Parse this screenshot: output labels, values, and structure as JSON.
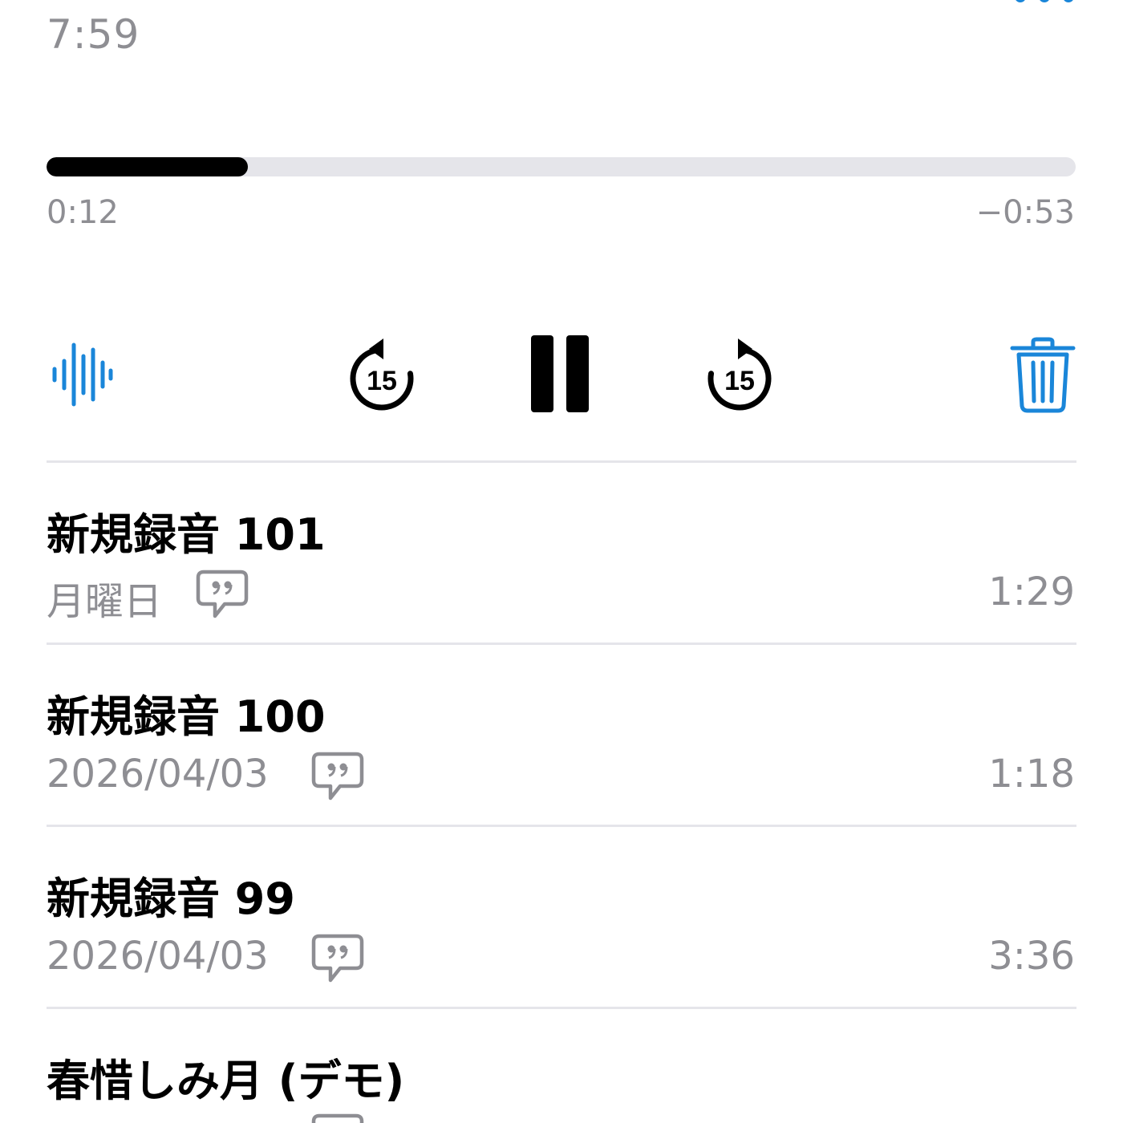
{
  "player": {
    "date_label": "7:59",
    "progress_fraction": 0.196,
    "elapsed": "0:12",
    "remaining": "−0:53"
  },
  "controls": {
    "waveform_icon": "waveform-icon",
    "skip_back_icon": "gobackward-15-icon",
    "skip_back_seconds": "15",
    "pause_icon": "pause-icon",
    "skip_forward_icon": "goforward-15-icon",
    "skip_forward_seconds": "15",
    "trash_icon": "trash-icon"
  },
  "colors": {
    "accent": "#1a86d9",
    "secondary_text": "#8e8e93",
    "track": "#e5e5ea"
  },
  "recordings": [
    {
      "title": "新規録音 101",
      "date": "月曜日",
      "duration": "1:29",
      "has_transcript": true
    },
    {
      "title": "新規録音 100",
      "date": "2026/04/03",
      "duration": "1:18",
      "has_transcript": true
    },
    {
      "title": "新規録音 99",
      "date": "2026/04/03",
      "duration": "3:36",
      "has_transcript": true
    },
    {
      "title": "春惜しみ月 (デモ)",
      "date": "",
      "duration": "",
      "has_transcript": true
    }
  ]
}
